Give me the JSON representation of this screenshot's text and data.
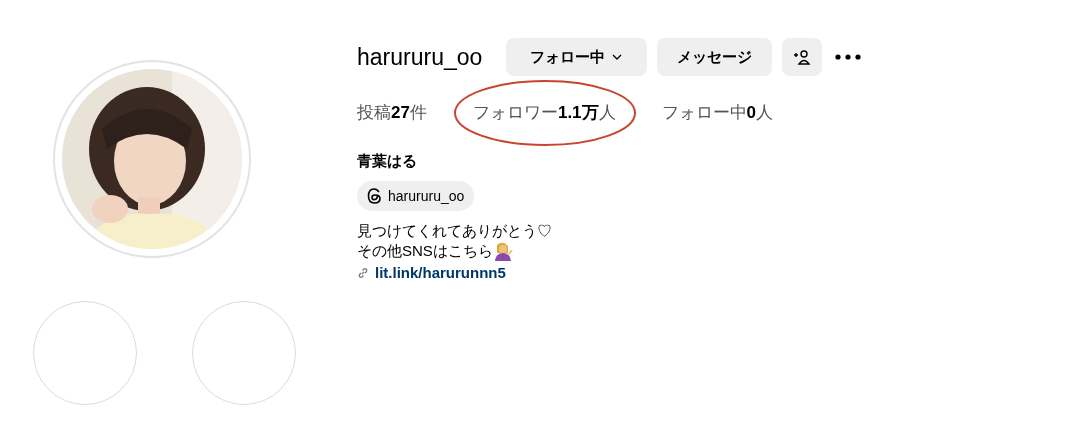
{
  "profile": {
    "username": "harururu_oo",
    "buttons": [
      {
        "kind": "dropdown",
        "label": "フォロー中"
      },
      {
        "kind": "plain",
        "label": "メッセージ"
      },
      {
        "kind": "add-person"
      },
      {
        "kind": "more"
      }
    ]
  },
  "stats": [
    {
      "text": "投稿**27**件",
      "highlighted": false
    },
    {
      "text": "フォロワー**1.1万**人",
      "highlighted": true
    },
    {
      "text": "フォロー中**0**人",
      "highlighted": false
    }
  ],
  "display_name": "青葉はる",
  "threads_chip": "harururu_oo",
  "bio": [
    "見つけてくれてありがとう♡",
    "その他SNSはこちら"
  ],
  "link": "lit.link/harurunnn5",
  "highlights": [
    {
      "kind": "empty"
    },
    {
      "kind": "empty"
    }
  ]
}
